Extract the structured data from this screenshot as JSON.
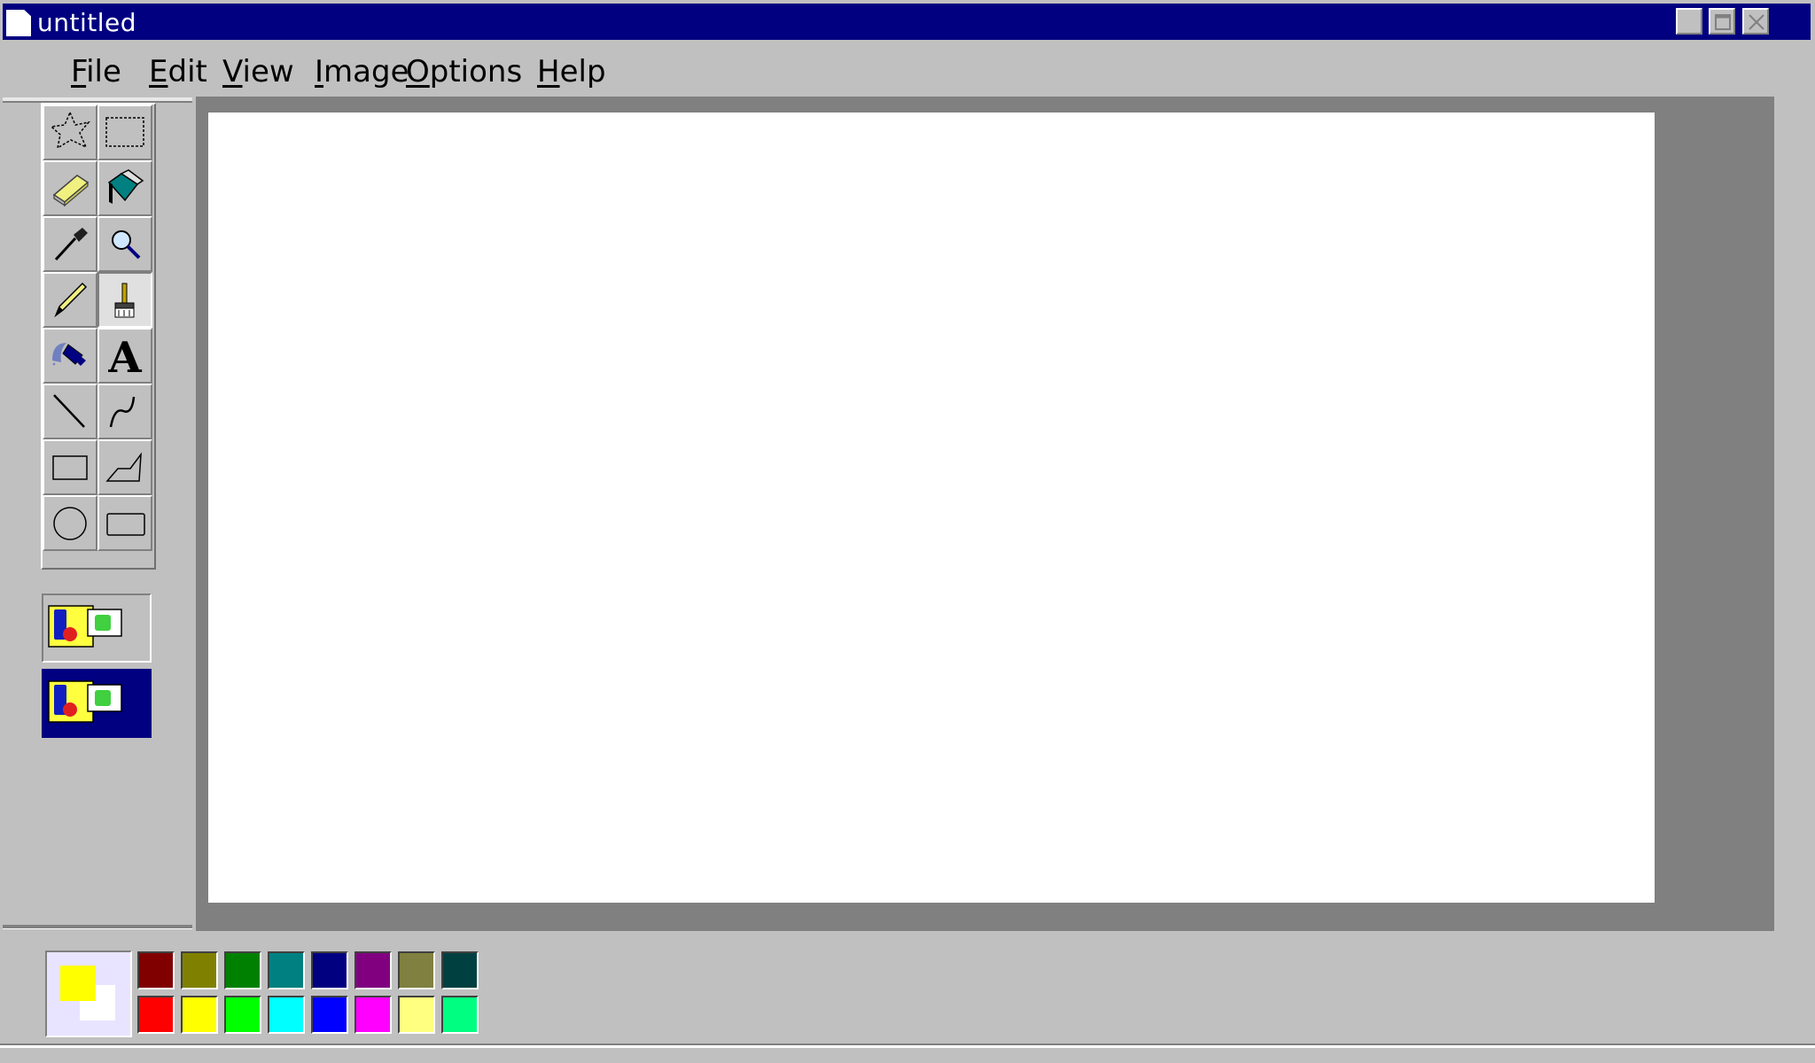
{
  "window": {
    "title": "untitled",
    "title_bar_color": "#000080",
    "controls": [
      "minimize-icon",
      "maximize-icon",
      "close-icon"
    ]
  },
  "menu": [
    {
      "label": "File",
      "mnemonic": "F"
    },
    {
      "label": "Edit",
      "mnemonic": "E"
    },
    {
      "label": "View",
      "mnemonic": "V"
    },
    {
      "label": "Image",
      "mnemonic": "I"
    },
    {
      "label": "Options",
      "mnemonic": "O"
    },
    {
      "label": "Help",
      "mnemonic": "H"
    }
  ],
  "tools": [
    {
      "name": "free-form-select",
      "icon": "star-select-icon"
    },
    {
      "name": "rectangle-select",
      "icon": "rect-select-icon"
    },
    {
      "name": "eraser",
      "icon": "eraser-icon"
    },
    {
      "name": "fill-with-color",
      "icon": "paint-bucket-icon"
    },
    {
      "name": "pick-color",
      "icon": "eyedropper-icon"
    },
    {
      "name": "magnifier",
      "icon": "magnifier-icon"
    },
    {
      "name": "pencil",
      "icon": "pencil-icon"
    },
    {
      "name": "brush",
      "icon": "brush-icon",
      "active": true
    },
    {
      "name": "airbrush",
      "icon": "airbrush-icon"
    },
    {
      "name": "text",
      "icon": "text-icon",
      "glyph": "A"
    },
    {
      "name": "line",
      "icon": "line-icon"
    },
    {
      "name": "curve",
      "icon": "curve-icon"
    },
    {
      "name": "rectangle",
      "icon": "rectangle-icon"
    },
    {
      "name": "polygon",
      "icon": "polygon-icon"
    },
    {
      "name": "ellipse",
      "icon": "ellipse-icon"
    },
    {
      "name": "rounded-rectangle",
      "icon": "rounded-rectangle-icon"
    }
  ],
  "tool_options": [
    {
      "name": "opaque-background",
      "icon": "opaque-option-icon",
      "selected": false
    },
    {
      "name": "transparent-background",
      "icon": "transparent-option-icon",
      "selected": true
    }
  ],
  "colors": {
    "foreground": "#ffff00",
    "background": "#ffffff",
    "palette_top": [
      "#800000",
      "#808000",
      "#008000",
      "#008080",
      "#000080",
      "#800080",
      "#808040",
      "#004040"
    ],
    "palette_bottom": [
      "#ff0000",
      "#ffff00",
      "#00ff00",
      "#00ffff",
      "#0000ff",
      "#ff00ff",
      "#ffff80",
      "#00ff80"
    ]
  },
  "canvas": {
    "background": "#ffffff"
  }
}
